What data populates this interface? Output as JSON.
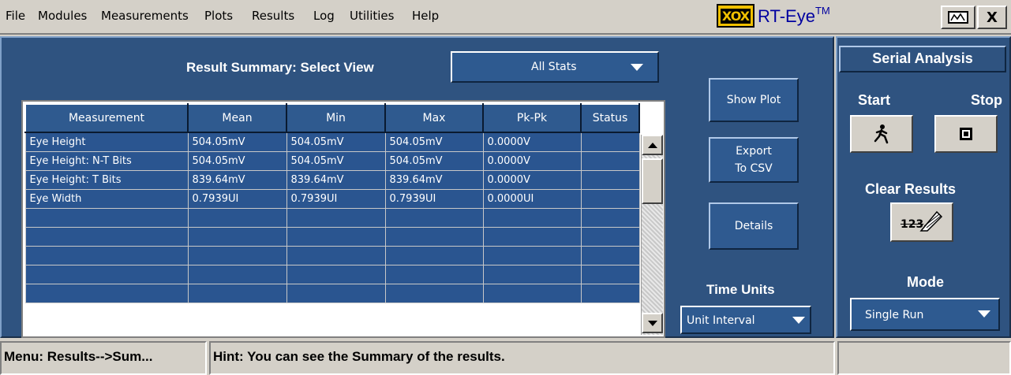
{
  "menu": [
    "File",
    "Modules",
    "Measurements",
    "Plots",
    "Results",
    "Log",
    "Utilities",
    "Help"
  ],
  "brand": {
    "logo_text": "XOX",
    "name": "RT-Eye",
    "trademark": "TM"
  },
  "window": {
    "close_label": "X"
  },
  "summary": {
    "select_view_label": "Result Summary: Select View",
    "select_view_value": "All Stats"
  },
  "table": {
    "columns": [
      "Measurement",
      "Mean",
      "Min",
      "Max",
      "Pk-Pk",
      "Status"
    ],
    "rows": [
      [
        "Eye Height",
        "504.05mV",
        "504.05mV",
        "504.05mV",
        "0.0000V",
        ""
      ],
      [
        "Eye Height: N-T Bits",
        "504.05mV",
        "504.05mV",
        "504.05mV",
        "0.0000V",
        ""
      ],
      [
        "Eye Height: T Bits",
        "839.64mV",
        "839.64mV",
        "839.64mV",
        "0.0000V",
        ""
      ],
      [
        "Eye Width",
        "0.7939UI",
        "0.7939UI",
        "0.7939UI",
        "0.0000UI",
        ""
      ],
      [
        "",
        "",
        "",
        "",
        "",
        ""
      ],
      [
        "",
        "",
        "",
        "",
        "",
        ""
      ],
      [
        "",
        "",
        "",
        "",
        "",
        ""
      ],
      [
        "",
        "",
        "",
        "",
        "",
        ""
      ],
      [
        "",
        "",
        "",
        "",
        "",
        ""
      ]
    ]
  },
  "actions": {
    "show_plot": "Show Plot",
    "export_line1": "Export",
    "export_line2": "To CSV",
    "details": "Details"
  },
  "time_units": {
    "label": "Time Units",
    "value": "Unit Interval"
  },
  "serial_analysis": {
    "title": "Serial Analysis",
    "start_label": "Start",
    "stop_label": "Stop",
    "clear_results_label": "Clear Results",
    "clear_icon_text": "123",
    "mode_label": "Mode",
    "mode_value": "Single Run"
  },
  "status": {
    "menu_path": "Menu: Results-->Sum...",
    "hint": "Hint: You can see the Summary of the results."
  },
  "colors": {
    "panel": "#2f5380",
    "cell": "#2a5590",
    "menubar": "#d4d0c8",
    "logo": "#f0c000"
  }
}
